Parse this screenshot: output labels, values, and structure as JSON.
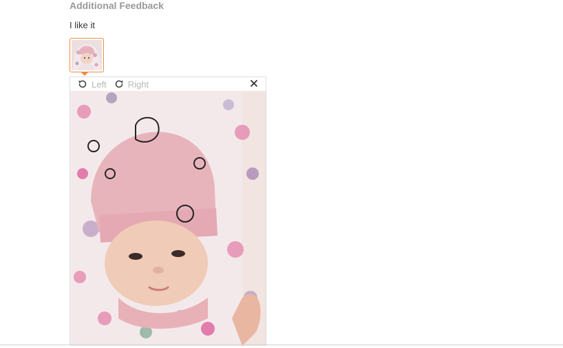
{
  "section": {
    "title": "Additional Feedback"
  },
  "feedback": {
    "text": "I like it"
  },
  "viewer": {
    "rotate_left_label": "Left",
    "rotate_right_label": "Right"
  },
  "colors": {
    "accent_border": "#f08a3c",
    "muted_text": "#999999",
    "disabled_text": "#b7b7b7"
  },
  "icons": {
    "rotate_left": "rotate-left-icon",
    "rotate_right": "rotate-right-icon",
    "close": "close-icon"
  }
}
